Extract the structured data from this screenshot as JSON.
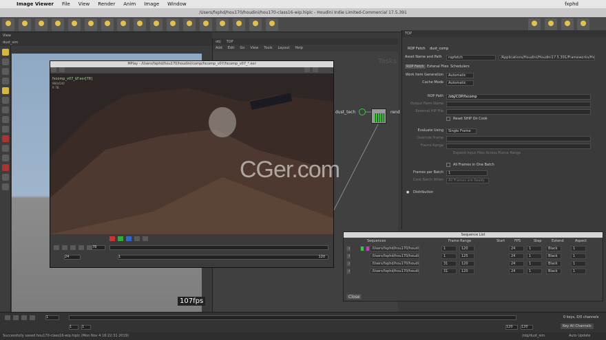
{
  "menubar": {
    "app": "Image Viewer",
    "items": [
      "File",
      "View",
      "Render",
      "Anim",
      "Image",
      "Window"
    ],
    "right": "fxphd"
  },
  "window_title": "/Users/fxphd/hou170/houdini/hou170-class16-wip.hiplc - Houdini Indie Limited-Commercial 17.5.391",
  "viewer": {
    "tab": "View",
    "path": "dust_sim",
    "fps": "107fps"
  },
  "mplay": {
    "title": "MPlay - /Users/fxphd/hou170/houdini/comp/fxcomp_v07/fxcomp_v07_*.exr",
    "info_file": "fxcomp_v07_$F.exr[78]",
    "info_res": "960x540",
    "info_frame": "fr 78",
    "frame": "78",
    "range_start": "1",
    "range_end": "120",
    "fps": "24"
  },
  "network": {
    "path_left": "obj",
    "path_right": "TOP",
    "menu": [
      "Add",
      "Edit",
      "Go",
      "View",
      "Tools",
      "Layout",
      "Help"
    ],
    "tab": "Tasks",
    "node_label": "dust_tech",
    "node_label2": "rend"
  },
  "params": {
    "header": "ROP Fetch",
    "node": "dust_comp",
    "asset_label": "Asset Name and Path",
    "asset_value": "ropfetch",
    "asset_path": "/Applications/Houdini/Houdini17.5.391/Frameworks/Houdini...",
    "tabs": [
      "ROP Fetch",
      "Extenal Files",
      "Schedulers"
    ],
    "work_item_label": "Work Item Generation",
    "work_item_value": "Automatic",
    "cache_label": "Cache Mode",
    "cache_value": "Automatic",
    "rop_path_label": "ROP Path",
    "rop_path_value": "/obj/COP/fxcomp",
    "output_label": "Output Parm Name",
    "ext_hip_label": "External HIP File",
    "reset_label": "Reset SHIP On Cook",
    "evaluate_label": "Evaluate Using",
    "evaluate_value": "Single Frame",
    "override_label": "Override Frame",
    "range_label": "Frame Range",
    "expand_label": "Expand Input Files Across Frame Range",
    "batch_label": "All Frames in One Batch",
    "per_batch_label": "Frames per Batch",
    "per_batch_value": "1",
    "cook_batch_label": "Cook Batch When",
    "cook_batch_value": "All Frames are Ready",
    "distribution_label": "Distribution"
  },
  "sequence": {
    "title": "Sequence List",
    "headers": [
      "Sequences",
      "Frame Range",
      "Start",
      "FPS",
      "Step",
      "Extend",
      "Aspect"
    ],
    "rows": [
      {
        "path": "/Users/fxphd/hou170/houdini/co",
        "start": "1",
        "end": "120",
        "fps": "24",
        "step": "1",
        "extend": "Black",
        "aspect": "1"
      },
      {
        "path": "/Users/fxphd/hou170/houdini/ren",
        "start": "1",
        "end": "125",
        "fps": "24",
        "step": "1",
        "extend": "Black",
        "aspect": "1"
      },
      {
        "path": "/Users/fxphd/hou170/houdini/ren",
        "start": "31",
        "end": "120",
        "fps": "24",
        "step": "1",
        "extend": "Black",
        "aspect": "1"
      },
      {
        "path": "/Users/fxphd/hou170/houdini/ren",
        "start": "31",
        "end": "120",
        "fps": "24",
        "step": "1",
        "extend": "Black",
        "aspect": "1"
      }
    ],
    "close": "Close"
  },
  "timeline": {
    "frame": "1",
    "start": "1",
    "end": "1",
    "range_end": "120",
    "range_end2": "120",
    "keys": "0 keys, 0/0 channels",
    "key_all": "Key All Channels",
    "auto_update": "Auto Update",
    "obj_path": "/obj/dust_sim"
  },
  "status": "Successfully saved hou170-class16-wip.hiplc (Mon Nov 4 16:22:31 2019)",
  "watermark": "CGer.com",
  "logo": "fxphd",
  "colors": {
    "accent": "#d6b63c",
    "node_green": "#33cc33"
  }
}
